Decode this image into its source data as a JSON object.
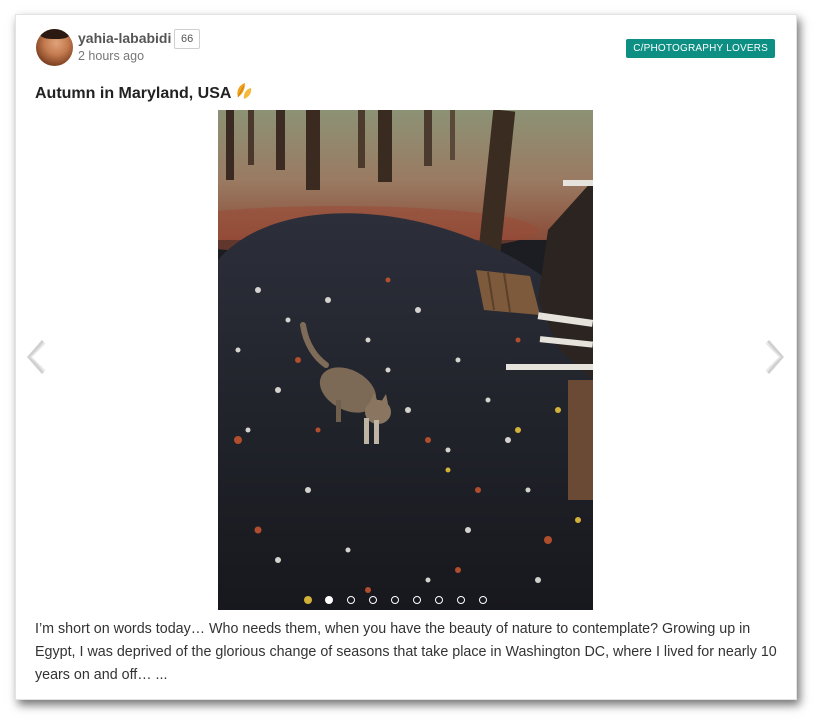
{
  "post": {
    "author": "yahia-lababidi",
    "reputation": "66",
    "timestamp": "2 hours ago",
    "community": "C/PHOTOGRAPHY LOVERS",
    "title": "Autumn in Maryland, USA",
    "title_emoji": "🍂",
    "body": "I’m short on words today… Who needs them, when you have the beauty of nature to contemplate? Growing up in Egypt, I was deprived of the glorious change of seasons that take place in Washington DC, where I lived for nearly 10 years on and off… ...",
    "gallery": {
      "slide_count": 8,
      "active_index": 0
    }
  },
  "colors": {
    "community_tag_bg": "#0e8f84",
    "text_primary": "#222222",
    "text_muted": "#777777"
  },
  "icons": {
    "prev": "chevron-left-icon",
    "next": "chevron-right-icon"
  }
}
